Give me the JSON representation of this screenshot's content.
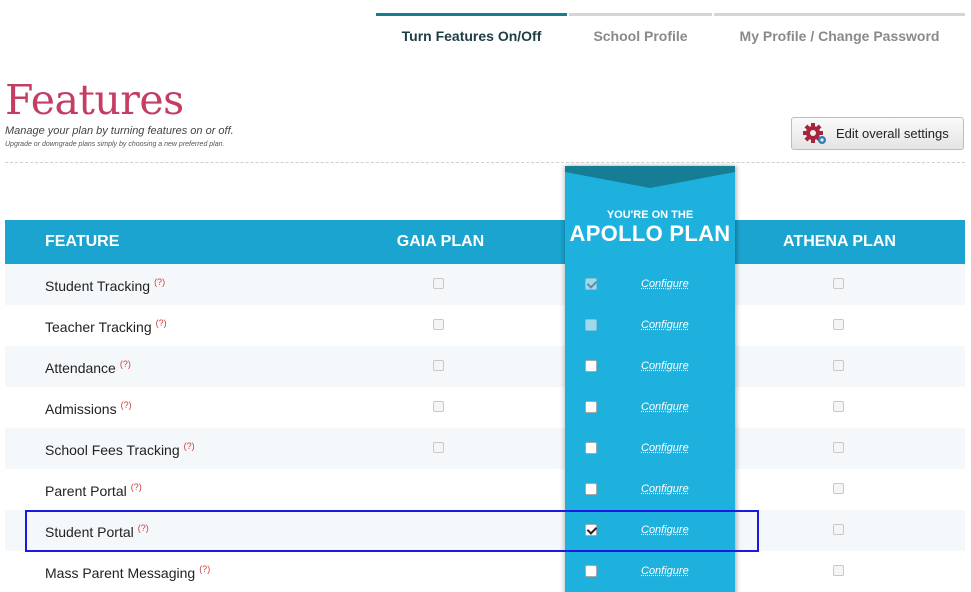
{
  "tabs": [
    {
      "label": "Turn Features On/Off",
      "active": true
    },
    {
      "label": "School Profile",
      "active": false
    },
    {
      "label": "My Profile / Change Password",
      "active": false
    }
  ],
  "header": {
    "title": "Features",
    "subtitle": "Manage your plan by turning features on or off.",
    "note": "Upgrade or downgrade plans simply by choosing a new preferred plan.",
    "edit_button_label": "Edit overall settings"
  },
  "table": {
    "columns": {
      "feature": "FEATURE",
      "gaia": "GAIA PLAN",
      "apollo_line1": "YOU'RE ON THE",
      "apollo_line2": "APOLLO PLAN",
      "athena": "ATHENA PLAN"
    },
    "help_marker": "(?)",
    "configure_label": "Configure",
    "rows": [
      {
        "feature": "Student Tracking",
        "gaia": true,
        "apollo_checked": true,
        "apollo_disabled": true,
        "athena": true
      },
      {
        "feature": "Teacher Tracking",
        "gaia": true,
        "apollo_checked": false,
        "apollo_disabled": true,
        "athena": true
      },
      {
        "feature": "Attendance",
        "gaia": true,
        "apollo_checked": false,
        "apollo_disabled": false,
        "athena": true
      },
      {
        "feature": "Admissions",
        "gaia": true,
        "apollo_checked": false,
        "apollo_disabled": false,
        "athena": true
      },
      {
        "feature": "School Fees Tracking",
        "gaia": true,
        "apollo_checked": false,
        "apollo_disabled": false,
        "athena": true
      },
      {
        "feature": "Parent Portal",
        "gaia": false,
        "apollo_checked": false,
        "apollo_disabled": false,
        "athena": true
      },
      {
        "feature": "Student Portal",
        "gaia": false,
        "apollo_checked": true,
        "apollo_disabled": false,
        "athena": true
      },
      {
        "feature": "Mass Parent Messaging",
        "gaia": false,
        "apollo_checked": false,
        "apollo_disabled": false,
        "athena": true
      }
    ]
  },
  "colors": {
    "accent": "#1aa4cf",
    "apollo": "#1fb1dd",
    "title": "#c43e63",
    "highlight": "#1a1ae0"
  }
}
